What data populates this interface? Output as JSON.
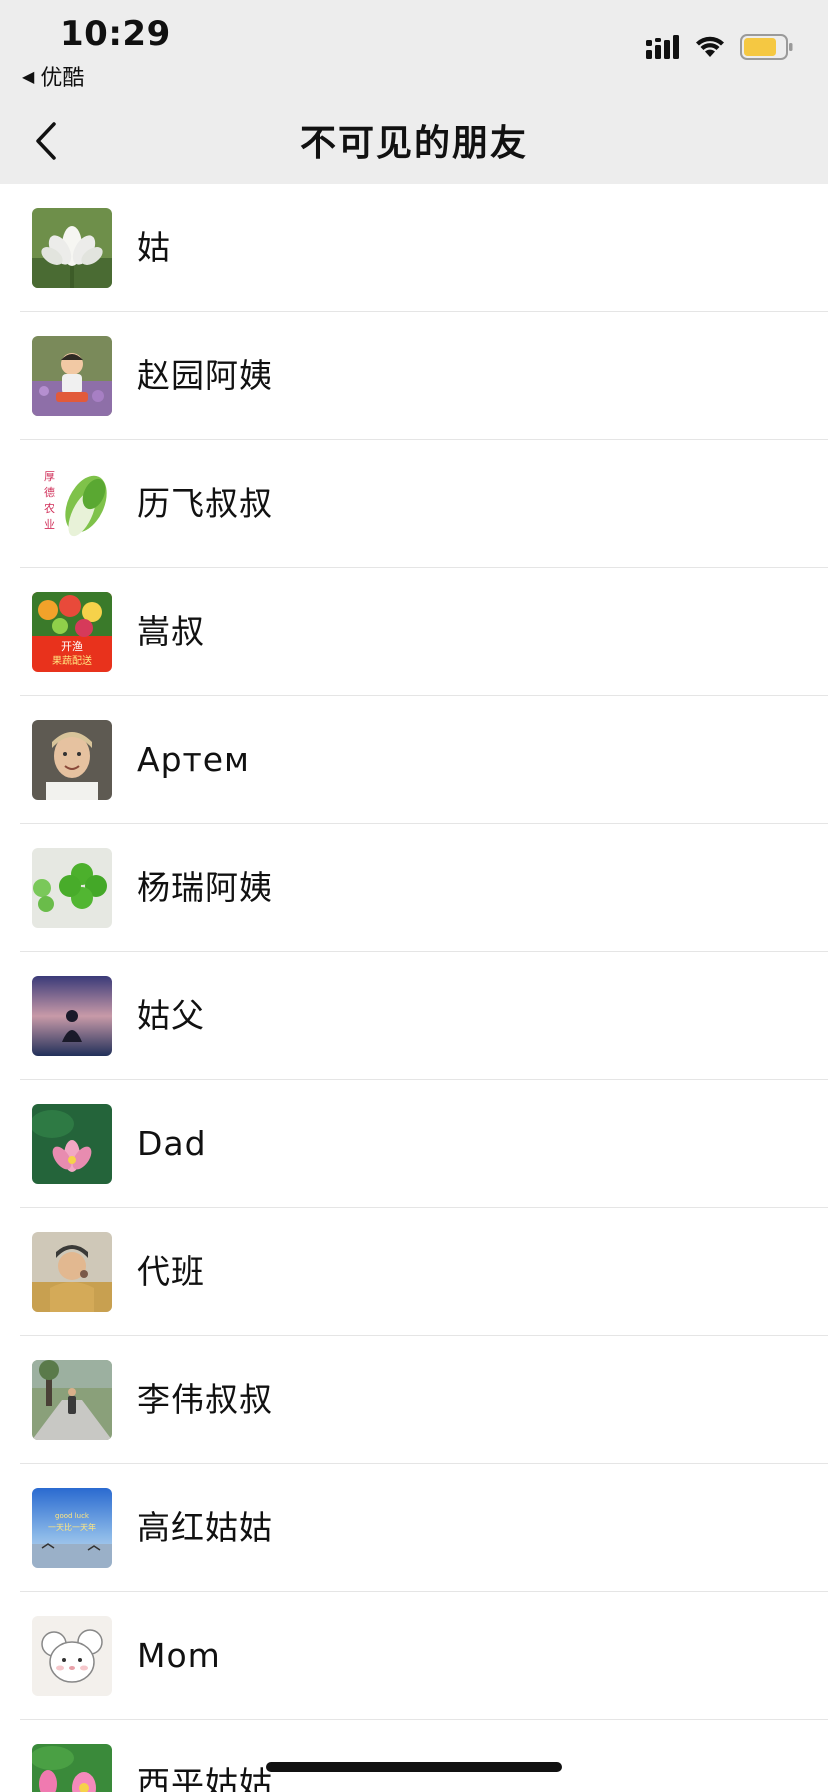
{
  "status_bar": {
    "time": "10:29",
    "back_app_label": "优酷",
    "battery_color": "#f5c842"
  },
  "nav": {
    "title": "不可见的朋友"
  },
  "contacts": [
    {
      "name": "姑",
      "avatar": "white-lotus-avatar"
    },
    {
      "name": "赵园阿姨",
      "avatar": "child-in-garden-avatar"
    },
    {
      "name": "历飞叔叔",
      "avatar": "bok-choy-farm-avatar",
      "avatar_text": [
        "厚",
        "德",
        "农",
        "业"
      ]
    },
    {
      "name": "嵩叔",
      "avatar": "fruit-delivery-avatar",
      "avatar_text": [
        "开渔",
        "果蔬配送"
      ]
    },
    {
      "name": "Артем",
      "avatar": "man-portrait-avatar"
    },
    {
      "name": "杨瑞阿姨",
      "avatar": "clover-avatar"
    },
    {
      "name": "姑父",
      "avatar": "sunset-silhouette-avatar"
    },
    {
      "name": "Dad",
      "avatar": "pink-lotus-avatar"
    },
    {
      "name": "代班",
      "avatar": "elder-man-avatar"
    },
    {
      "name": "李伟叔叔",
      "avatar": "park-path-avatar"
    },
    {
      "name": "高红姑姑",
      "avatar": "blue-sky-lake-avatar",
      "avatar_text": [
        "good luck",
        "一天比一天年"
      ]
    },
    {
      "name": "Mom",
      "avatar": "cartoon-mouse-avatar"
    },
    {
      "name": "西平姑姑",
      "avatar": "pink-flower-avatar"
    }
  ]
}
